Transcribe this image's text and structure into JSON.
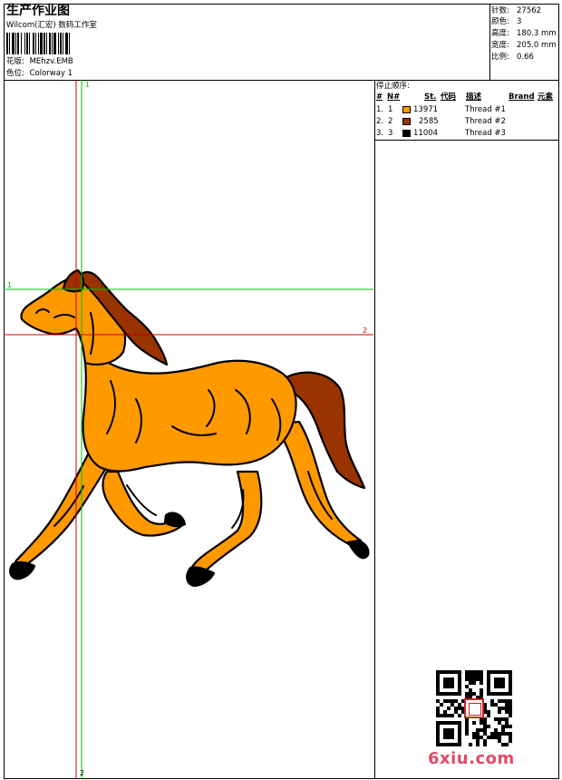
{
  "header": {
    "title": "生产作业图",
    "company": "Wilcom(汇宏) 数码工作室",
    "design_label": "花版:",
    "design_value": "MEhzv.EMB",
    "colorway_label": "色位:",
    "colorway_value": "Colorway 1"
  },
  "stats": [
    {
      "label": "针数:",
      "value": "27562"
    },
    {
      "label": "颜色:",
      "value": "3"
    },
    {
      "label": "高度:",
      "value": "180.3 mm"
    },
    {
      "label": "宽度:",
      "value": "205.0 mm"
    },
    {
      "label": "比例:",
      "value": "0.66"
    }
  ],
  "stop_sequence": {
    "title": "停止顺序:",
    "headers": {
      "hash": "#",
      "no": "N#",
      "st": "St.",
      "code": "代码",
      "desc": "描述",
      "brand": "Brand",
      "element": "元素"
    },
    "rows": [
      {
        "index": "1.",
        "no": "1",
        "code": "13971",
        "desc": "Thread #1",
        "color": "#ff9900"
      },
      {
        "index": "2.",
        "no": "2",
        "code": "2585",
        "desc": "Thread #2",
        "color": "#993300"
      },
      {
        "index": "3.",
        "no": "3",
        "code": "11004",
        "desc": "Thread #3",
        "color": "#000000"
      }
    ]
  },
  "guides": {
    "green_v_top": "1",
    "green_h_left": "1",
    "red_h_right": "2",
    "red_v_bottom": "2"
  },
  "watermark": {
    "text": "6xiu.com"
  },
  "colors": {
    "horse_body": "#ff9900",
    "horse_mane": "#993300",
    "outline": "#000000",
    "guide_green": "#00c000",
    "guide_red": "#cc0000",
    "watermark": "#e34a6a"
  }
}
